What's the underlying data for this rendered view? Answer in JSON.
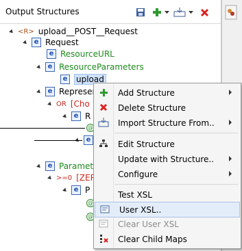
{
  "panel": {
    "title": "Output Structures",
    "toolbar_icons": [
      "save-icon",
      "add-icon",
      "import-icon",
      "dropdown-icon",
      "delete-icon"
    ]
  },
  "tree": [
    {
      "label": "upload__POST__Request",
      "prefix": "<R>",
      "style": "normal"
    },
    {
      "label": "Request",
      "style": "normal"
    },
    {
      "label": "ResourceURL",
      "style": "green"
    },
    {
      "label": "ResourceParameters",
      "style": "green"
    },
    {
      "label": "upload",
      "style": "selected"
    },
    {
      "label": "Represen",
      "style": "normal"
    },
    {
      "label": "[Cho",
      "prefix": "OR",
      "style": "red"
    },
    {
      "label": "R",
      "style": "normal"
    },
    {
      "label": "Paramete",
      "style": "green"
    },
    {
      "label": "[ZERO",
      "prefix": ">=0",
      "style": "red"
    },
    {
      "label": "P",
      "style": "normal"
    }
  ],
  "context_menu": {
    "items": [
      {
        "label": "Add Structure",
        "icon": "plus-icon",
        "submenu": true,
        "enabled": true
      },
      {
        "label": "Delete Structure",
        "icon": "delete-x-icon",
        "submenu": false,
        "enabled": true
      },
      {
        "label": "Import Structure From..",
        "icon": "import-icon",
        "submenu": true,
        "enabled": true
      },
      {
        "label": "Edit Structure",
        "icon": "structure-icon",
        "submenu": false,
        "enabled": true
      },
      {
        "label": "Update with Structure..",
        "icon": "",
        "submenu": true,
        "enabled": true
      },
      {
        "label": "Configure",
        "icon": "",
        "submenu": true,
        "enabled": true
      },
      {
        "label": "Test XSL",
        "icon": "",
        "submenu": false,
        "enabled": true
      },
      {
        "label": "User XSL..",
        "icon": "script-icon",
        "submenu": false,
        "enabled": true,
        "hovered": true
      },
      {
        "label": "Clear User XSL",
        "icon": "script-clear-icon",
        "submenu": false,
        "enabled": false
      },
      {
        "label": "Clear Child Maps",
        "icon": "clear-maps-icon",
        "submenu": false,
        "enabled": true
      }
    ]
  },
  "colors": {
    "green": "#1e8a1e",
    "red": "#c8281e",
    "selection": "#cfe2fb",
    "menu_bg": "#f5f5f5"
  }
}
